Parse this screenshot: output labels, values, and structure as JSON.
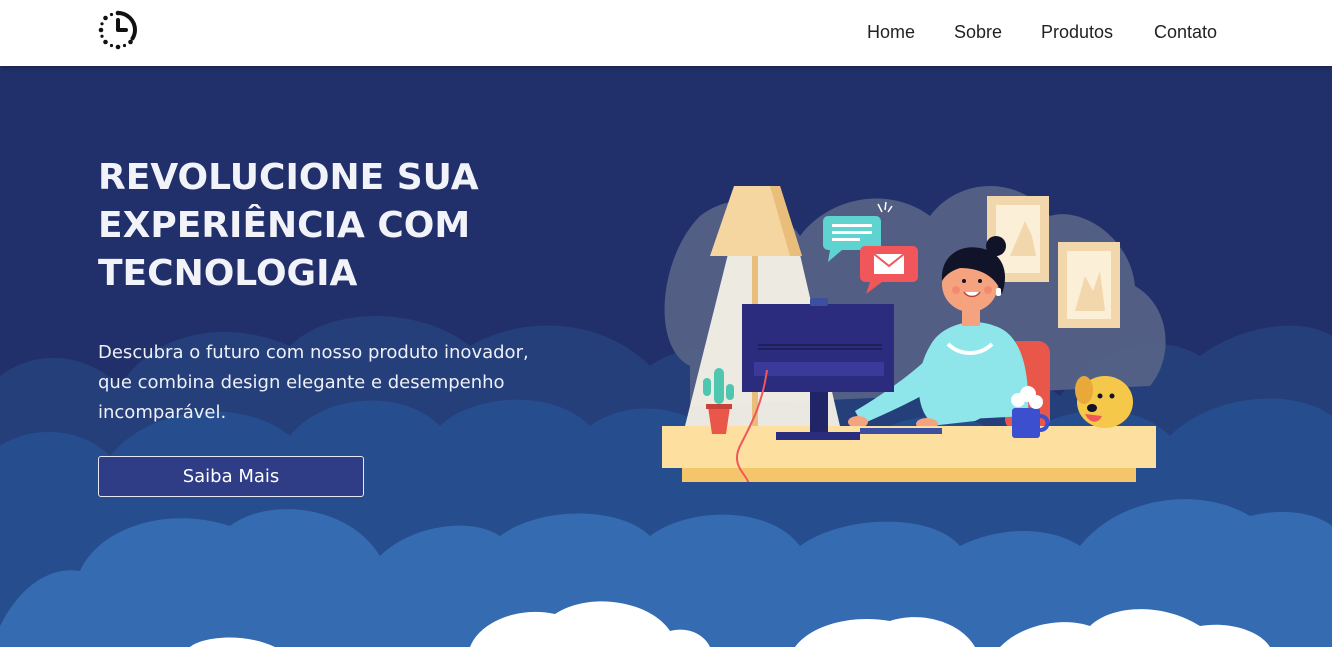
{
  "header": {
    "logo_icon": "clock-history-icon",
    "nav": [
      {
        "label": "Home"
      },
      {
        "label": "Sobre"
      },
      {
        "label": "Produtos"
      },
      {
        "label": "Contato"
      }
    ]
  },
  "hero": {
    "title": "REVOLUCIONE SUA EXPERIÊNCIA COM TECNOLOGIA",
    "description": "Descubra o futuro com nosso produto inovador, que combina design elegante e desempenho incomparável.",
    "cta_label": "Saiba Mais"
  },
  "colors": {
    "header_bg": "#ffffff",
    "hero_bg": "#21306a",
    "cloud_mid": "#264b8b",
    "cloud_front": "#356bb0",
    "cloud_white": "#ffffff",
    "button_bg": "#2f3d87"
  }
}
